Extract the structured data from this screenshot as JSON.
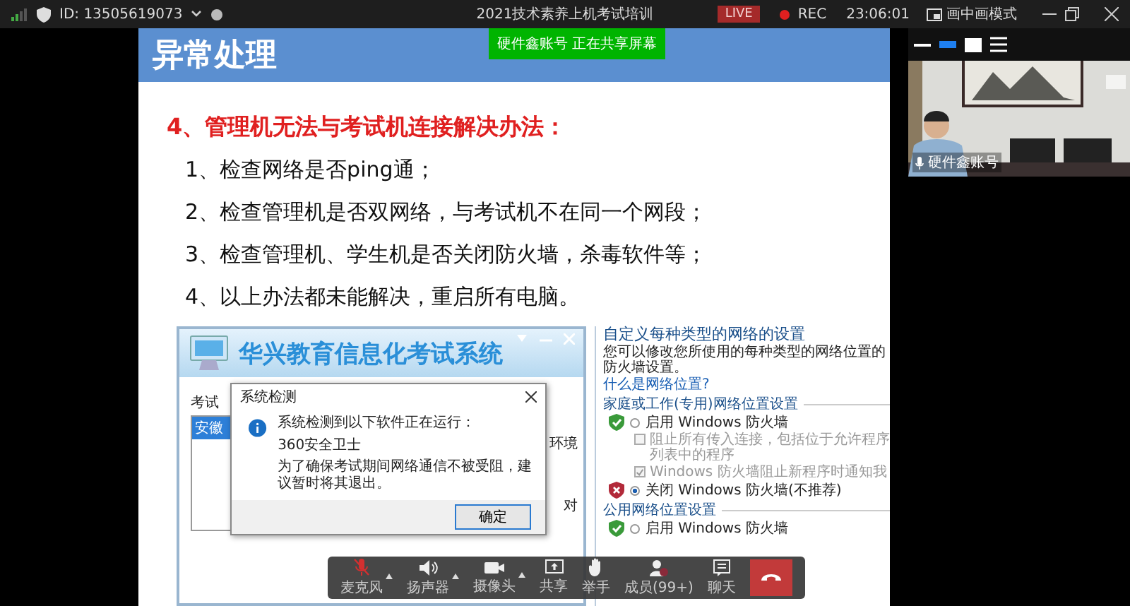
{
  "titlebar": {
    "meeting_id": "ID: 13505619073",
    "title": "2021技术素养上机考试培训",
    "live_badge": "LIVE",
    "rec_label": "REC",
    "timer": "23:06:01",
    "pip_label": "画中画模式"
  },
  "share_banner": "硬件鑫账号  正在共享屏幕",
  "slide": {
    "title": "异常处理",
    "heading": "4、管理机无法与考试机连接解决办法：",
    "items": [
      "1、检查网络是否ping通；",
      "2、检查管理机是否双网络，与考试机不在同一个网段；",
      "3、检查管理机、学生机是否关闭防火墙，杀毒软件等；",
      "4、以上办法都未能解决，重启所有电脑。"
    ]
  },
  "exam_window": {
    "title": "华兴教育信息化考试系统",
    "label": "考试",
    "list_items": [
      {
        "label": "安徽",
        "selected": true
      }
    ],
    "side_texts": [
      "环境",
      "对"
    ]
  },
  "dialog": {
    "title": "系统检测",
    "lines": [
      "系统检测到以下软件正在运行：",
      "360安全卫士",
      "为了确保考试期间网络通信不被受阻，建议暂时将其退出。"
    ],
    "button": "确定"
  },
  "firewall": {
    "title": "自定义每种类型的网络的设置",
    "description": "您可以修改您所使用的每种类型的网络位置的防火墙设置。",
    "link": "什么是网络位置?",
    "sections": [
      {
        "heading": "家庭或工作(专用)网络位置设置",
        "options": [
          {
            "kind": "radio",
            "label": "启用 Windows 防火墙",
            "selected": false,
            "warning": false
          },
          {
            "kind": "checkbox",
            "label": "阻止所有传入连接，包括位于允许程序列表中的程序",
            "checked": false,
            "disabled": true
          },
          {
            "kind": "checkbox",
            "label": "Windows 防火墙阻止新程序时通知我",
            "checked": true,
            "disabled": true
          },
          {
            "kind": "radio",
            "label": "关闭 Windows 防火墙(不推荐)",
            "selected": true,
            "warning": true
          }
        ]
      },
      {
        "heading": "公用网络位置设置",
        "options": [
          {
            "kind": "radio",
            "label": "启用 Windows 防火墙",
            "selected": false,
            "warning": false
          }
        ]
      }
    ]
  },
  "video": {
    "name": "硬件鑫账号"
  },
  "toolbar": {
    "items": [
      {
        "kind": "mic",
        "label": "麦克风",
        "muted": true,
        "has_menu": true
      },
      {
        "kind": "speaker",
        "label": "扬声器",
        "has_menu": true
      },
      {
        "kind": "camera",
        "label": "摄像头",
        "has_menu": true
      },
      {
        "kind": "share",
        "label": "共享"
      },
      {
        "kind": "hand",
        "label": "举手"
      },
      {
        "kind": "members",
        "label": "成员(99+)"
      },
      {
        "kind": "chat",
        "label": "聊天"
      },
      {
        "kind": "end"
      }
    ]
  }
}
